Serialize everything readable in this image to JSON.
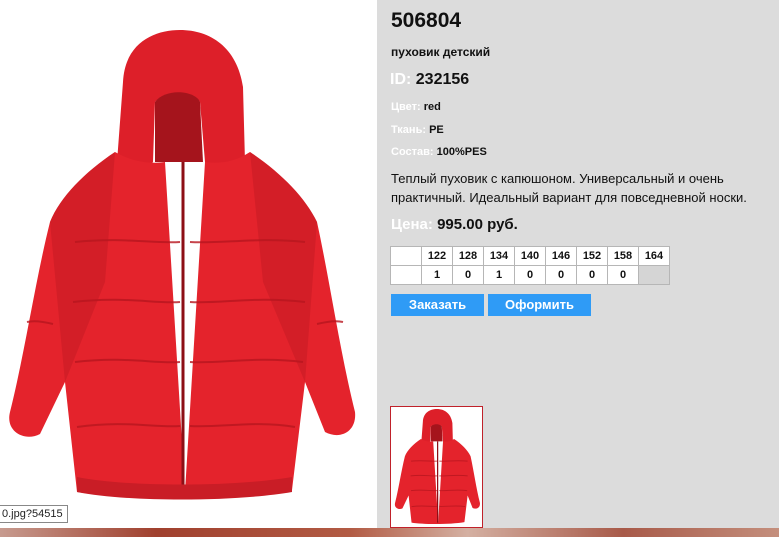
{
  "status_url": "0.jpg?54515",
  "product": {
    "article": "506804",
    "name": "пуховик детский",
    "id_label": "ID:",
    "id_value": "232156",
    "attributes": {
      "color_label": "Цвет:",
      "color_value": "red",
      "fabric_label": "Ткань:",
      "fabric_value": "PE",
      "composition_label": "Состав:",
      "composition_value": "100%PES"
    },
    "description": "Теплый пуховик с капюшоном. Универсальный и очень практичный. Идеальный вариант для повседневной носки.",
    "price_label": "Цена:",
    "price_value": "995.00 руб.",
    "main_color": "#e4232c"
  },
  "sizes": {
    "header": [
      "",
      "122",
      "128",
      "134",
      "140",
      "146",
      "152",
      "158",
      "164"
    ],
    "quantities": [
      "",
      "1",
      "0",
      "1",
      "0",
      "0",
      "0",
      "0",
      ""
    ]
  },
  "buttons": {
    "order": "Заказать",
    "checkout": "Оформить"
  }
}
